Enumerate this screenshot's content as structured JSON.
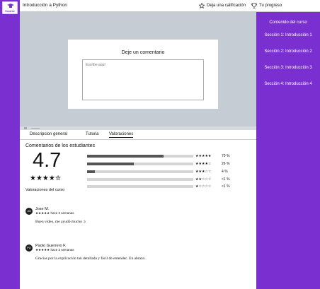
{
  "app": {
    "logo_text": "Course"
  },
  "header": {
    "course_title": "Introducción a Python",
    "rate_label": "Deja una calificación",
    "progress_label": "Tu progreso"
  },
  "modal": {
    "title": "Deje un comentario",
    "placeholder": "Escribe aquí"
  },
  "sidebar": {
    "title": "Contenido del curso",
    "sections": [
      {
        "label": "Sección 1: Introducción 1"
      },
      {
        "label": "Sección 2: Introducción 2"
      },
      {
        "label": "Sección 3: Introducción 3"
      },
      {
        "label": "Sección 4: Introducción 4"
      }
    ]
  },
  "tabs": [
    {
      "label": "Descripcion general"
    },
    {
      "label": "Tutoria"
    },
    {
      "label": "Valoraciones",
      "active": true
    }
  ],
  "reviews": {
    "heading": "Comentarios de los estudiantes",
    "average": "4.7",
    "average_stars": "★★★★✮",
    "ratings_label": "Valoraciones del curso",
    "distribution": [
      {
        "stars": "★★★★★",
        "percent": "70 %",
        "fill": 0.72
      },
      {
        "stars": "★★★★☆",
        "percent": "26 %",
        "fill": 0.44
      },
      {
        "stars": "★★★☆☆",
        "percent": "4 %",
        "fill": 0.07
      },
      {
        "stars": "★★☆☆☆",
        "percent": "<1 %",
        "fill": 0.0
      },
      {
        "stars": "★☆☆☆☆",
        "percent": "<1 %",
        "fill": 0.0
      }
    ],
    "comments": [
      {
        "initials": "JM",
        "name": "Jose M.",
        "stars": "★★★★★",
        "time": "hace 2 semanas",
        "text": "Buen video, me ayudó mucho :)"
      },
      {
        "initials": "PG",
        "name": "Paolo Guerrero F.",
        "stars": "★★★★★",
        "time": "hace 3 semanas",
        "text": "Gracias por la explicación tan detallada y fácil de entender. Un abrazo."
      }
    ]
  }
}
